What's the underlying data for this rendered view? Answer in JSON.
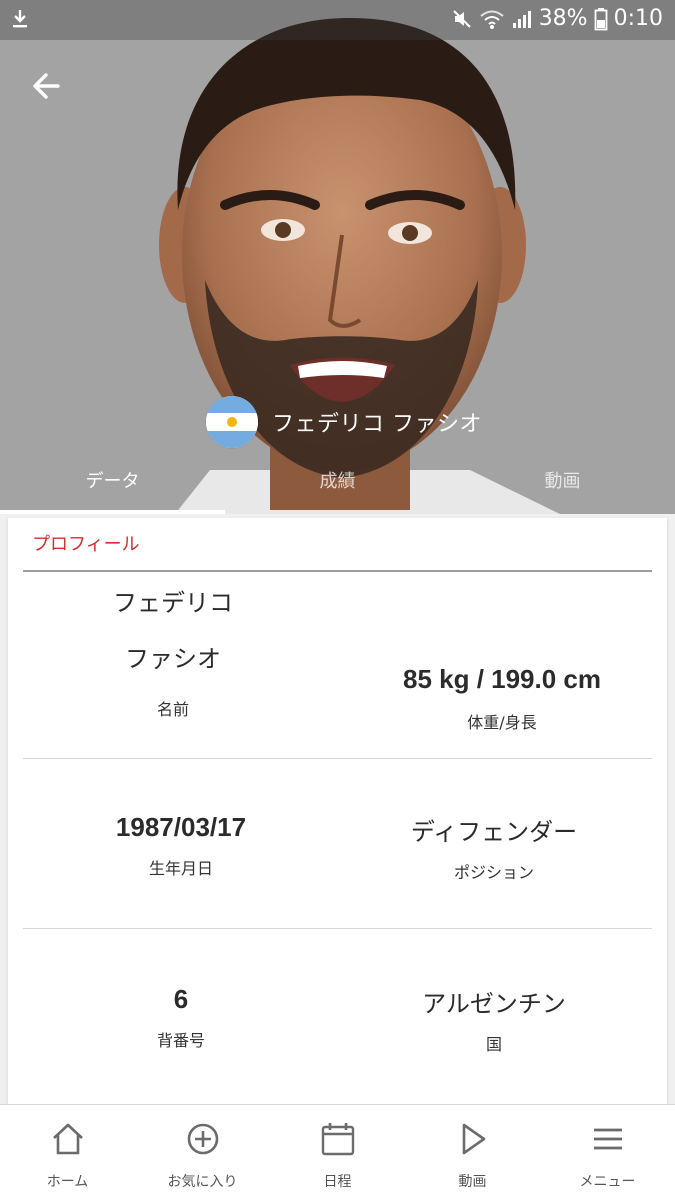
{
  "status_bar": {
    "battery": "38%",
    "time": "0:10"
  },
  "player": {
    "display_name": "フェデリコ ファシオ",
    "country_flag": "argentina-flag-icon"
  },
  "tabs": [
    {
      "label": "データ",
      "active": true
    },
    {
      "label": "成績",
      "active": false
    },
    {
      "label": "動画",
      "active": false
    }
  ],
  "profile": {
    "section_title": "プロフィール",
    "name_first": "フェデリコ",
    "name_last": "ファシオ",
    "name_label": "名前",
    "weight_height": "85 kg / 199.0 cm",
    "weight_height_label": "体重/身長",
    "birthdate": "1987/03/17",
    "birthdate_label": "生年月日",
    "position": "ディフェンダー",
    "position_label": "ポジション",
    "number": "6",
    "number_label": "背番号",
    "country": "アルゼンチン",
    "country_label": "国"
  },
  "bottom_nav": [
    {
      "label": "ホーム",
      "icon": "home-icon"
    },
    {
      "label": "お気に入り",
      "icon": "add-circle-icon"
    },
    {
      "label": "日程",
      "icon": "calendar-icon"
    },
    {
      "label": "動画",
      "icon": "play-icon"
    },
    {
      "label": "メニュー",
      "icon": "menu-icon"
    }
  ],
  "colors": {
    "accent_red": "#d32f2f",
    "hero_bg": "#a3a3a3",
    "flag_blue": "#74acdf",
    "sun_yellow": "#f6b40e"
  }
}
